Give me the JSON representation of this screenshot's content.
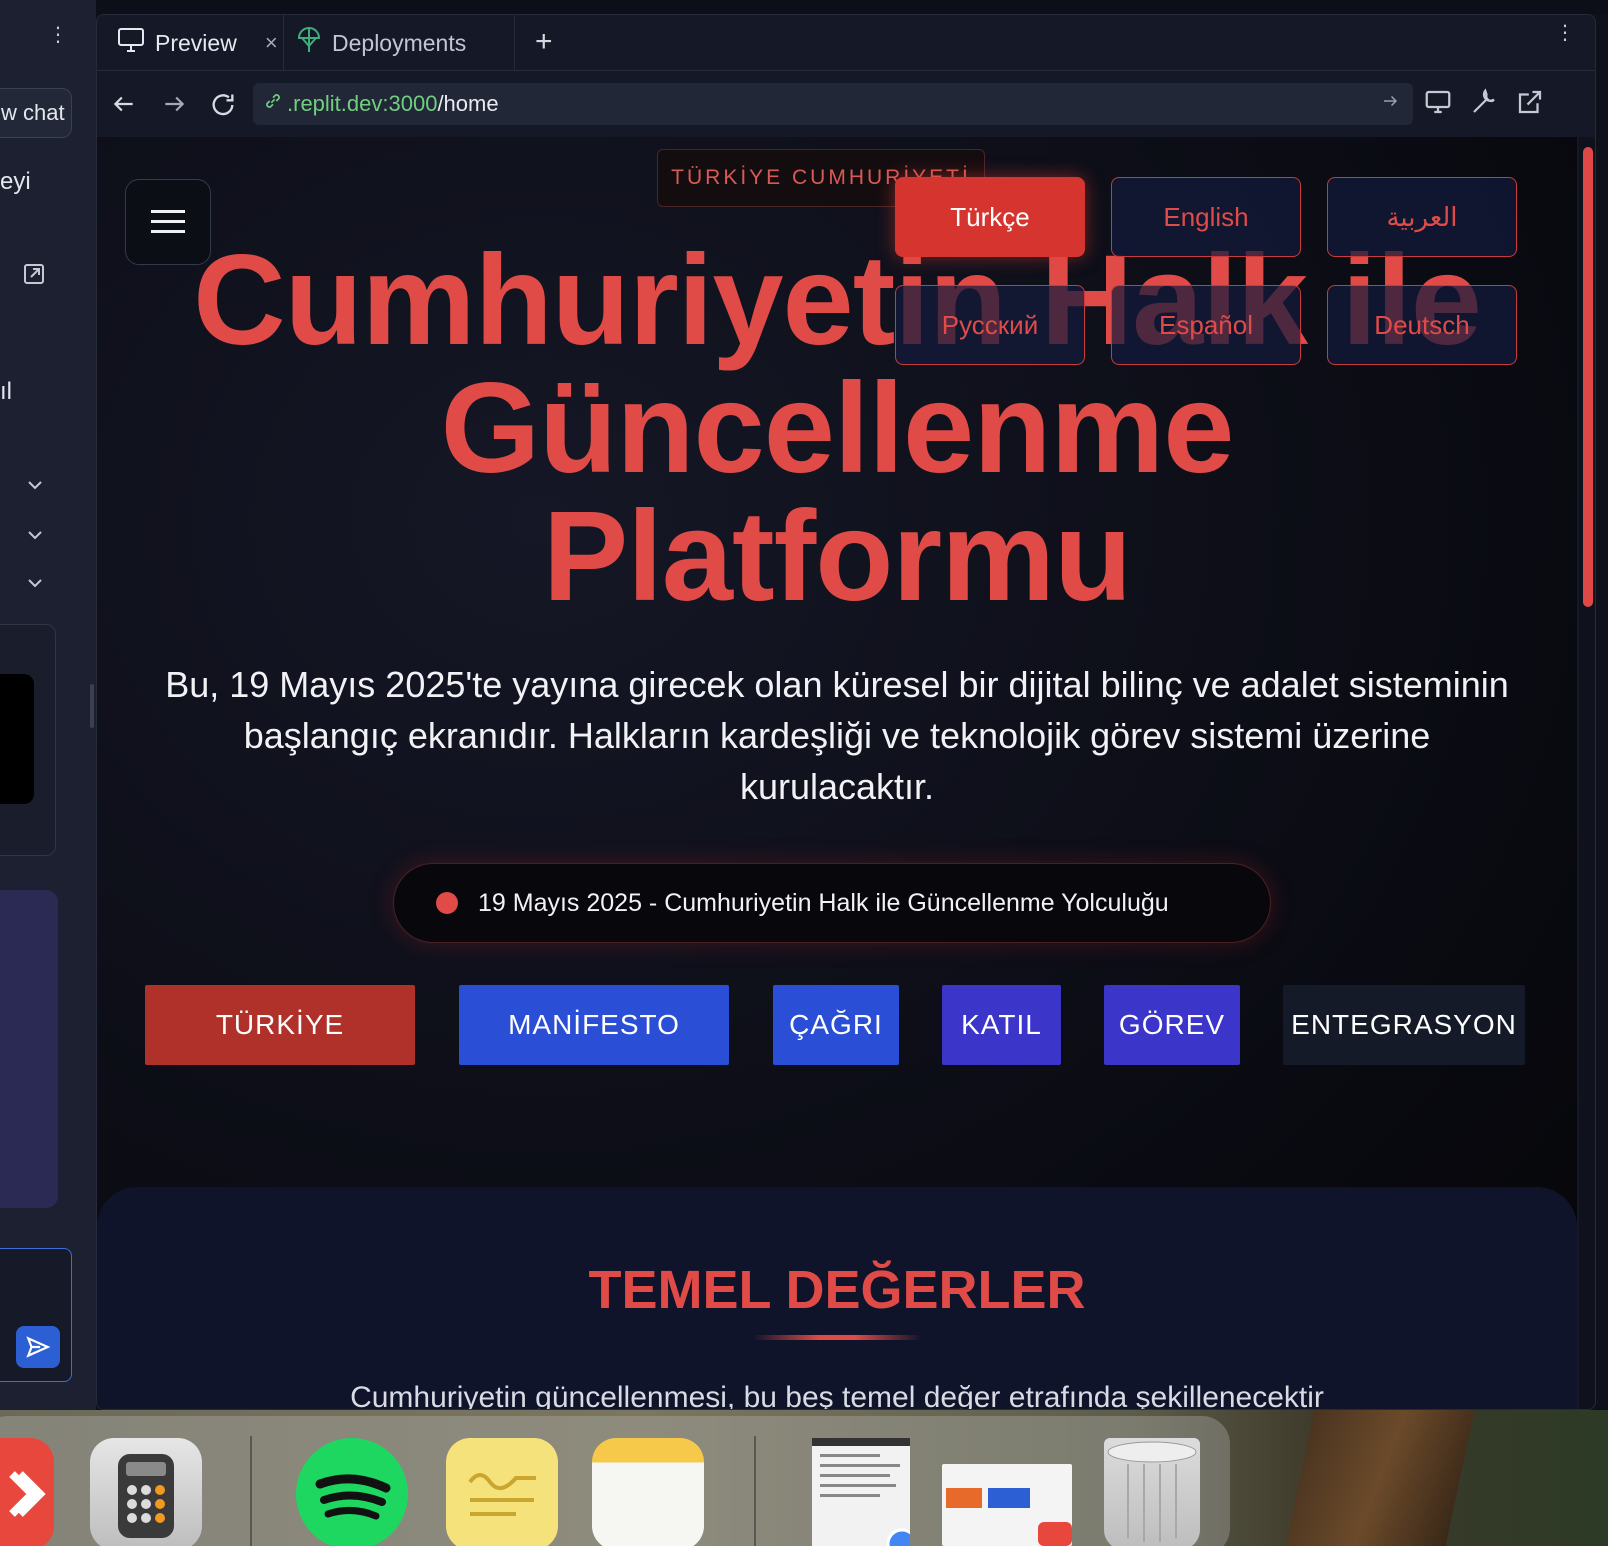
{
  "left_sidebar": {
    "chat_button_label": "w chat",
    "text_1": "eyi",
    "text_2": "ıl"
  },
  "tabs": {
    "preview_label": "Preview",
    "deployments_label": "Deployments",
    "close_symbol": "×",
    "add_symbol": "+"
  },
  "address_bar": {
    "host": ".replit.dev:3000",
    "path": "/home"
  },
  "page": {
    "top_badge": "TÜRKİYE CUMHURİYETİ",
    "hero_title_line1": "Cumhuriyetin Halk ile",
    "hero_title_line2": "Güncellenme",
    "hero_title_line3": "Platformu",
    "languages": [
      "Türkçe",
      "English",
      "العربية",
      "Русский",
      "Español",
      "Deutsch"
    ],
    "active_language": "Türkçe",
    "subtitle": "Bu, 19 Mayıs 2025'te yayına girecek olan küresel bir dijital bilinç ve adalet sisteminin başlangıç ekranıdır. Halkların kardeşliği ve teknolojik görev sistemi üzerine kurulacaktır.",
    "pill_text": "19 Mayıs 2025 - Cumhuriyetin Halk ile Güncellenme Yolculuğu",
    "nav_buttons": [
      {
        "label": "TÜRKİYE",
        "color": "#b0302a"
      },
      {
        "label": "MANİFESTO",
        "color": "#2a4fd6"
      },
      {
        "label": "ÇAĞRI",
        "color": "#2a4fd6"
      },
      {
        "label": "KATIL",
        "color": "#3b35c9"
      },
      {
        "label": "GÖREV",
        "color": "#3b35c9"
      },
      {
        "label": "ENTEGRASYON",
        "color": "#151a28"
      }
    ],
    "section_title": "TEMEL DEĞERLER",
    "section_text": "Cumhuriyetin güncellenmesi, bu beş temel değer etrafında şekillenecektir"
  },
  "colors": {
    "accent_red": "#e04b48",
    "url_green": "#6fcf7e"
  },
  "dock": {
    "apps": [
      "app-icon",
      "calculator-icon",
      "spotify-icon",
      "stickies-icon",
      "notes-icon",
      "document-thumbnail",
      "window-thumbnail",
      "trash-icon"
    ]
  }
}
